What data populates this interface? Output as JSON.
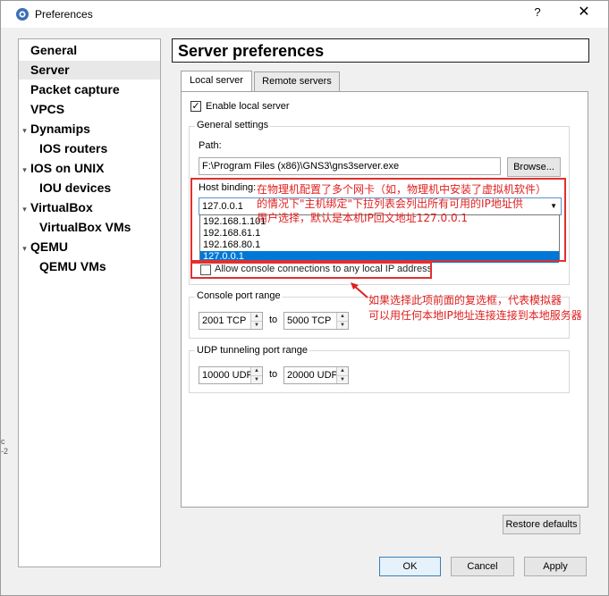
{
  "window": {
    "title": "Preferences",
    "help_glyph": "?",
    "close_glyph": "✕"
  },
  "sidebar": {
    "items": [
      {
        "label": "General",
        "level": 0,
        "selected": false
      },
      {
        "label": "Server",
        "level": 0,
        "selected": true
      },
      {
        "label": "Packet capture",
        "level": 0,
        "selected": false
      },
      {
        "label": "VPCS",
        "level": 0,
        "selected": false
      },
      {
        "label": "Dynamips",
        "level": 0,
        "expanded": true
      },
      {
        "label": "IOS routers",
        "level": 1
      },
      {
        "label": "IOS on UNIX",
        "level": 0,
        "expanded": true
      },
      {
        "label": "IOU devices",
        "level": 1
      },
      {
        "label": "VirtualBox",
        "level": 0,
        "expanded": true
      },
      {
        "label": "VirtualBox VMs",
        "level": 1
      },
      {
        "label": "QEMU",
        "level": 0,
        "expanded": true
      },
      {
        "label": "QEMU VMs",
        "level": 1
      }
    ]
  },
  "page": {
    "title": "Server preferences",
    "tabs": [
      {
        "label": "Local server",
        "active": true
      },
      {
        "label": "Remote servers",
        "active": false
      }
    ]
  },
  "local_server": {
    "enable_label": "Enable local server",
    "enable_checked": true,
    "general_settings_title": "General settings",
    "path_label": "Path:",
    "path_value": "F:\\Program Files (x86)\\GNS3\\gns3server.exe",
    "browse_label": "Browse...",
    "host_binding_label": "Host binding:",
    "host_binding_value": "127.0.0.1",
    "host_binding_options": [
      "192.168.1.101",
      "192.168.61.1",
      "192.168.80.1",
      "127.0.0.1"
    ],
    "host_binding_selected_index": 3,
    "allow_console_label": "Allow console connections to any local IP address",
    "allow_console_checked": false,
    "console_group_title": "Console port range",
    "console_from": "2001 TCP",
    "console_to": "5000 TCP",
    "to_label": "to",
    "udp_group_title": "UDP tunneling port range",
    "udp_from": "10000 UDP",
    "udp_to": "20000 UDP"
  },
  "buttons": {
    "restore_defaults": "Restore defaults",
    "ok": "OK",
    "cancel": "Cancel",
    "apply": "Apply"
  },
  "annotations": {
    "host_binding_note_lines": [
      "在物理机配置了多个网卡（如，物理机中安装了虚拟机软件）",
      "的情况下\"主机绑定\"下拉列表会列出所有可用的IP地址供",
      "用户选择，默认是本机IP回文地址127.0.0.1"
    ],
    "console_note_lines": [
      "如果选择此项前面的复选框，代表模拟器",
      "可以用任何本地IP地址连接连接到本地服务器"
    ],
    "color": "#e02020"
  },
  "edge_fragments": [
    "c",
    "-2"
  ]
}
